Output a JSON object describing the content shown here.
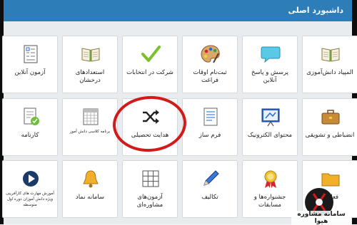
{
  "header": {
    "title": "داشبورد اصلی"
  },
  "tiles": {
    "r0": [
      "المپیاد دانش‌آموزی",
      "پرسش و پاسخ آنلاین",
      "ثبت‌نام اوقات فراغت",
      "شرکت در انتخابات",
      "استعدادهای درخشان",
      "آزمون آنلاین"
    ],
    "r1": [
      "انضباطی و تشویقی",
      "محتوای الکترونیک",
      "فرم ساز",
      "هدایت تحصیلی",
      "برنامه کلاسی دانش آموز",
      "کارنامه"
    ],
    "r2": [
      "فعالیت",
      "جشنواره‌ها و مسابقات",
      "تکالیف",
      "آزمون‌های مشاوره‌ای",
      "سامانه نماد",
      "آموزش مهارت های کارآفرینی ویژه دانش آموزان دوره اول متوسطه"
    ]
  },
  "watermark": {
    "text": "سامانه مشاوره هیوا"
  },
  "colors": {
    "header": "#2d7eb8",
    "highlight": "#d21a1a"
  }
}
